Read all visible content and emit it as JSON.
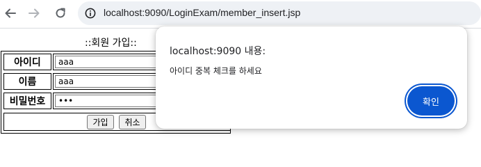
{
  "browser": {
    "url": "localhost:9090/LoginExam/member_insert.jsp"
  },
  "form": {
    "title": "::회원 가입::",
    "rows": [
      {
        "label": "아이디",
        "value": "aaa"
      },
      {
        "label": "이름",
        "value": "aaa"
      },
      {
        "label": "비밀번호",
        "value": "•••"
      }
    ],
    "submit_label": "가입",
    "cancel_label": "취소"
  },
  "dialog": {
    "title": "localhost:9090 내용:",
    "message": "아이디 중복 체크를 하세요",
    "ok_label": "확인"
  },
  "colors": {
    "accent": "#0b57d0",
    "address_bar": "#eef1f5"
  },
  "icons": [
    "back-arrow-icon",
    "forward-arrow-icon",
    "reload-icon",
    "site-info-icon"
  ]
}
